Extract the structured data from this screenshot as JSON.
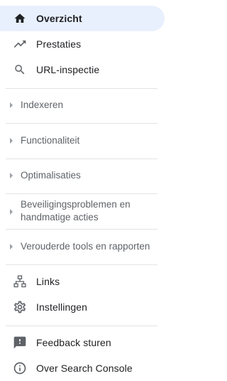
{
  "nav": {
    "overzicht": "Overzicht",
    "prestaties": "Prestaties",
    "url_inspectie": "URL-inspectie",
    "sections": {
      "indexeren": "Indexeren",
      "functionaliteit": "Functionaliteit",
      "optimalisaties": "Optimalisaties",
      "beveiliging_line1": "Beveiligingsproblemen en",
      "beveiliging_line2": "handmatige acties",
      "verouderde": "Verouderde tools en rapporten"
    },
    "links": "Links",
    "instellingen": "Instellingen",
    "feedback": "Feedback sturen",
    "over": "Over Search Console"
  },
  "colors": {
    "active_bg": "#e8f0fe",
    "icon": "#5f6368",
    "text": "#202124",
    "section_text": "#5f6368",
    "divider": "#e3e3e3"
  },
  "icons": {
    "overzicht": "home-icon",
    "prestaties": "trending-up-icon",
    "url_inspectie": "search-icon",
    "links": "sitemap-icon",
    "instellingen": "gear-icon",
    "feedback": "feedback-icon",
    "over": "info-icon"
  }
}
